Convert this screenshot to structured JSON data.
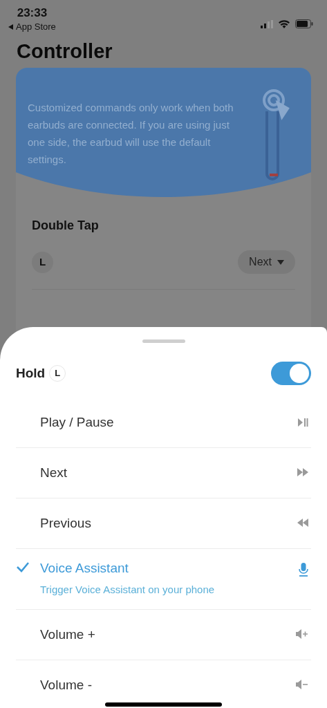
{
  "status_bar": {
    "time": "23:33",
    "back_label": "App Store"
  },
  "title": "Controller",
  "banner": {
    "text": "Customized commands only work when both earbuds are connected. If you are using just one side, the earbud will use the default settings."
  },
  "double_tap": {
    "heading": "Double Tap",
    "rows": [
      {
        "side": "L",
        "value": "Next"
      }
    ]
  },
  "sheet": {
    "title": "Hold",
    "side": "L",
    "on": true,
    "options": [
      {
        "label": "Play / Pause",
        "kind": "play-pause",
        "selected": false
      },
      {
        "label": "Next",
        "kind": "next",
        "selected": false
      },
      {
        "label": "Previous",
        "kind": "previous",
        "selected": false
      },
      {
        "label": "Voice Assistant",
        "description": "Trigger Voice Assistant on your phone",
        "kind": "mic",
        "selected": true
      },
      {
        "label": "Volume +",
        "kind": "volume-up",
        "selected": false
      },
      {
        "label": "Volume -",
        "kind": "volume-down",
        "selected": false
      }
    ]
  }
}
